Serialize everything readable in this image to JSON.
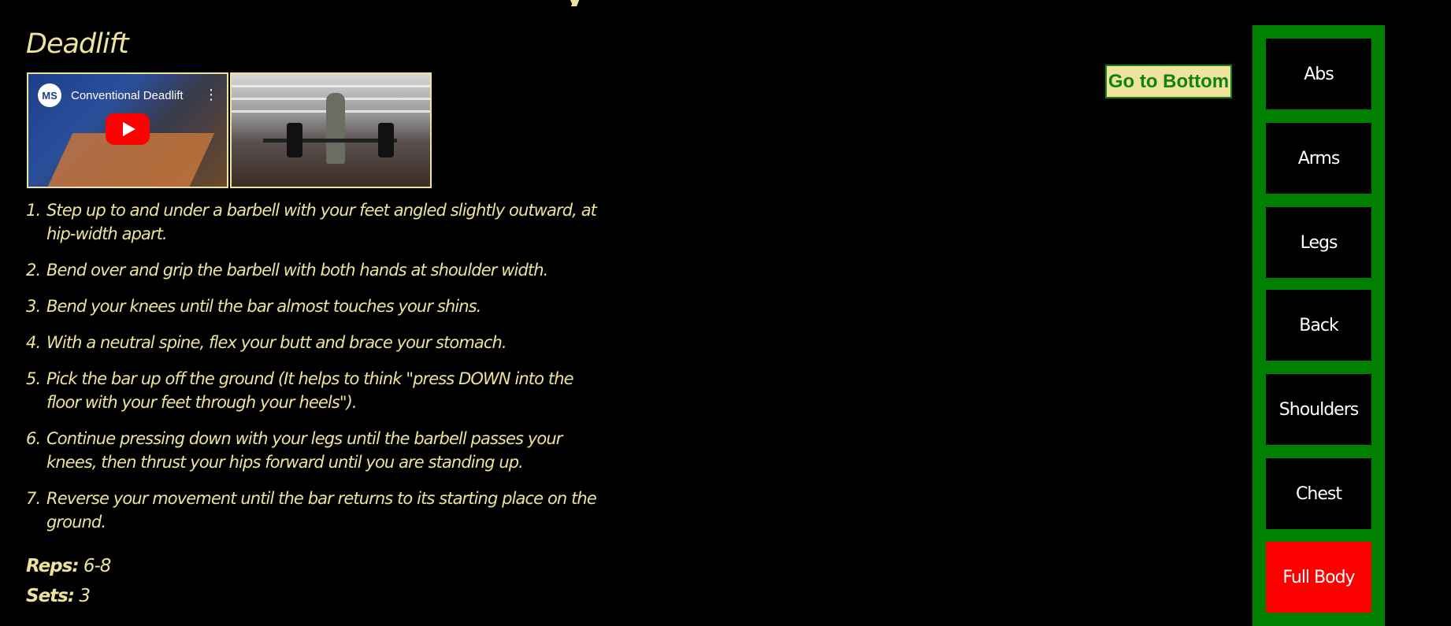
{
  "header": {
    "top_cut_text": "y"
  },
  "exercise": {
    "title": "Deadlift",
    "video": {
      "logo_text": "MS",
      "title": "Conventional Deadlift",
      "menu_glyph": "⋮"
    },
    "steps": [
      {
        "num": "1.",
        "text": "Step up to and under a barbell with your feet angled slightly outward, at hip-width apart."
      },
      {
        "num": "2.",
        "text": "Bend over and grip the barbell with both hands at shoulder width."
      },
      {
        "num": "3.",
        "text": "Bend your knees until the bar almost touches your shins."
      },
      {
        "num": "4.",
        "text": "With a neutral spine, flex your butt and brace your stomach."
      },
      {
        "num": "5.",
        "text": "Pick the bar up off the ground (It helps to think \"press DOWN into the floor with your feet through your heels\")."
      },
      {
        "num": "6.",
        "text": "Continue pressing down with your legs until the barbell passes your knees, then thrust your hips forward until you are standing up."
      },
      {
        "num": "7.",
        "text": "Reverse your movement until the bar returns to its starting place on the ground."
      }
    ],
    "reps_label": "Reps:",
    "reps_value": "6-8",
    "sets_label": "Sets:",
    "sets_value": "3"
  },
  "actions": {
    "goto_bottom_label": "Go to Bottom"
  },
  "sidebar": {
    "items": [
      {
        "label": "Abs",
        "active": false
      },
      {
        "label": "Arms",
        "active": false
      },
      {
        "label": "Legs",
        "active": false
      },
      {
        "label": "Back",
        "active": false
      },
      {
        "label": "Shoulders",
        "active": false
      },
      {
        "label": "Chest",
        "active": false
      },
      {
        "label": "Full Body",
        "active": true
      }
    ]
  },
  "colors": {
    "background": "#000000",
    "text": "#ede39b",
    "sidebar_green": "#008000",
    "active_red": "#ff0000",
    "button_text_green": "#118016"
  }
}
